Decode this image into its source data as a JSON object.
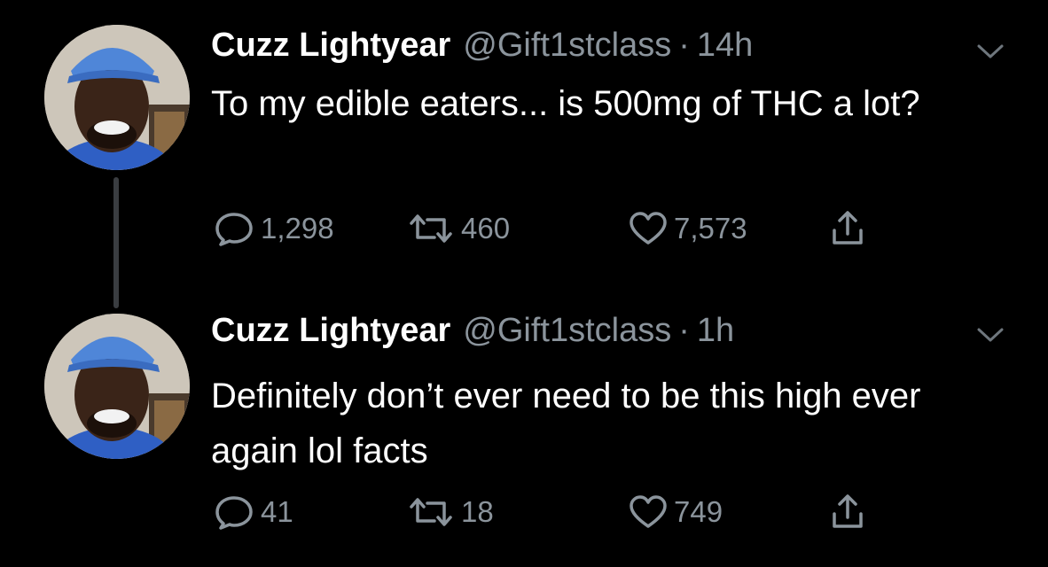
{
  "tweets": [
    {
      "name": "Cuzz Lightyear",
      "handle": "@Gift1stclass",
      "separator": "·",
      "time": "14h",
      "text": "To my edible eaters... is 500mg of THC a lot?",
      "replies": "1,298",
      "retweets": "460",
      "likes": "7,573"
    },
    {
      "name": "Cuzz Lightyear",
      "handle": "@Gift1stclass",
      "separator": "·",
      "time": "1h",
      "text": "Definitely don’t ever need to be this high ever again lol facts",
      "replies": "41",
      "retweets": "18",
      "likes": "749"
    }
  ],
  "colors": {
    "background": "#000000",
    "primary_text": "#ffffff",
    "secondary_text": "#8b949c",
    "thread_line": "#3a3d41"
  },
  "icons": [
    "reply-icon",
    "retweet-icon",
    "like-icon",
    "share-icon",
    "chevron-down-icon"
  ]
}
